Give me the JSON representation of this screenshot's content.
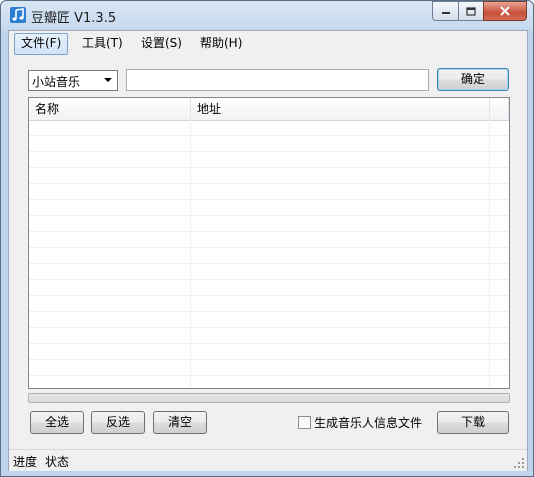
{
  "window": {
    "title": "豆瓣匠 V1.3.5"
  },
  "menu": {
    "items": [
      {
        "label": "文件(F)",
        "active": true
      },
      {
        "label": "工具(T)",
        "active": false
      },
      {
        "label": "设置(S)",
        "active": false
      },
      {
        "label": "帮助(H)",
        "active": false
      }
    ]
  },
  "toolbar": {
    "source_select": "小站音乐",
    "url_value": "",
    "confirm_label": "确定"
  },
  "table": {
    "columns": [
      "名称",
      "地址"
    ],
    "rows": []
  },
  "progress": {
    "value": 0
  },
  "actions": {
    "select_all_label": "全选",
    "invert_label": "反选",
    "clear_label": "清空",
    "generate_info_label": "生成音乐人信息文件",
    "generate_info_checked": false,
    "download_label": "下载"
  },
  "status": {
    "progress_label": "进度",
    "state_label": "状态"
  },
  "colors": {
    "accent": "#3c7fb1",
    "title_bar": "#c7d9ee",
    "close_button": "#c7503a"
  }
}
